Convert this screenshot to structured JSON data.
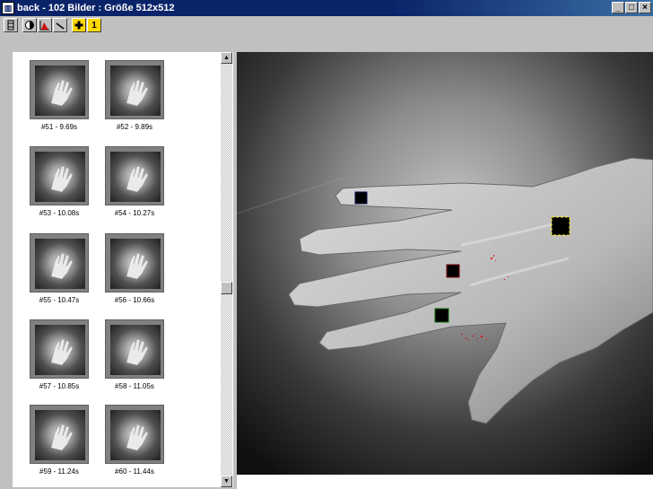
{
  "window": {
    "title": "back - 102 Bilder : Größe 512x512",
    "minimize": "_",
    "maximize": "□",
    "close": "×"
  },
  "toolbar": {
    "buttons": [
      {
        "name": "thumbnail-view",
        "icon": "film-strip-icon"
      },
      {
        "name": "contrast",
        "icon": "contrast-icon"
      },
      {
        "name": "histogram",
        "icon": "histogram-icon"
      },
      {
        "name": "pipette",
        "icon": "pipette-icon"
      },
      {
        "name": "add-roi",
        "icon": "plus-icon"
      },
      {
        "name": "roi-one",
        "icon": "number-one-icon",
        "label": "1"
      }
    ]
  },
  "thumbnails": [
    {
      "label": "#51 - 9.69s"
    },
    {
      "label": "#52 - 9.89s"
    },
    {
      "label": "#53 - 10.08s"
    },
    {
      "label": "#54 - 10.27s"
    },
    {
      "label": "#55 - 10.47s"
    },
    {
      "label": "#56 - 10.66s"
    },
    {
      "label": "#57 - 10.85s"
    },
    {
      "label": "#58 - 11.05s"
    },
    {
      "label": "#59 - 11.24s"
    },
    {
      "label": "#60 - 11.44s"
    }
  ],
  "scrollbar": {
    "up": "▲",
    "down": "▼"
  },
  "rois": [
    {
      "name": "blue",
      "color": "#1a2a8a"
    },
    {
      "name": "yellow",
      "color": "#e8e000"
    },
    {
      "name": "red",
      "color": "#cc1010"
    },
    {
      "name": "green",
      "color": "#1aa01a"
    }
  ],
  "colors": {
    "titlebar": "#0a246a",
    "face": "#c0c0c0"
  }
}
